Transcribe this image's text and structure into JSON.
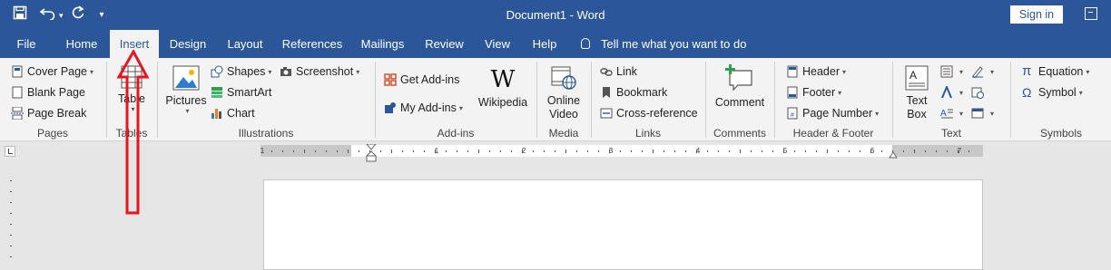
{
  "titlebar": {
    "document_title": "Document1  -  Word",
    "signin_label": "Sign in",
    "icons": [
      "save-icon",
      "undo-icon",
      "redo-icon",
      "customize-qat-icon",
      "ribbon-display-options-icon"
    ]
  },
  "tabs": [
    {
      "label": "File",
      "active": false
    },
    {
      "label": "Home",
      "active": false
    },
    {
      "label": "Insert",
      "active": true
    },
    {
      "label": "Design",
      "active": false
    },
    {
      "label": "Layout",
      "active": false
    },
    {
      "label": "References",
      "active": false
    },
    {
      "label": "Mailings",
      "active": false
    },
    {
      "label": "Review",
      "active": false
    },
    {
      "label": "View",
      "active": false
    },
    {
      "label": "Help",
      "active": false
    }
  ],
  "tellme": "Tell me what you want to do",
  "ribbon": {
    "pages": {
      "label": "Pages",
      "cover_page": "Cover Page",
      "blank_page": "Blank Page",
      "page_break": "Page Break"
    },
    "tables": {
      "label": "Tables",
      "table": "Table"
    },
    "illustrations": {
      "label": "Illustrations",
      "pictures": "Pictures",
      "shapes": "Shapes",
      "smartart": "SmartArt",
      "chart": "Chart",
      "screenshot": "Screenshot"
    },
    "addins": {
      "label": "Add-ins",
      "get_addins": "Get Add-ins",
      "my_addins": "My Add-ins",
      "wikipedia": "Wikipedia",
      "wikipedia_glyph": "W"
    },
    "media": {
      "label": "Media",
      "online_video_1": "Online",
      "online_video_2": "Video"
    },
    "links": {
      "label": "Links",
      "link": "Link",
      "bookmark": "Bookmark",
      "cross_reference": "Cross-reference"
    },
    "comments": {
      "label": "Comments",
      "comment": "Comment"
    },
    "header_footer": {
      "label": "Header & Footer",
      "header": "Header",
      "footer": "Footer",
      "page_number": "Page Number"
    },
    "text": {
      "label": "Text",
      "text_box_1": "Text",
      "text_box_2": "Box"
    },
    "symbols": {
      "label": "Symbols",
      "equation": "Equation",
      "symbol": "Symbol",
      "pi_glyph": "π",
      "omega_glyph": "Ω"
    }
  },
  "ruler": {
    "numbers": [
      "1",
      "1",
      "2",
      "3",
      "4",
      "5",
      "6",
      "7"
    ]
  },
  "colors": {
    "brand": "#2b579a",
    "annotation_arrow": "#e8141e"
  }
}
